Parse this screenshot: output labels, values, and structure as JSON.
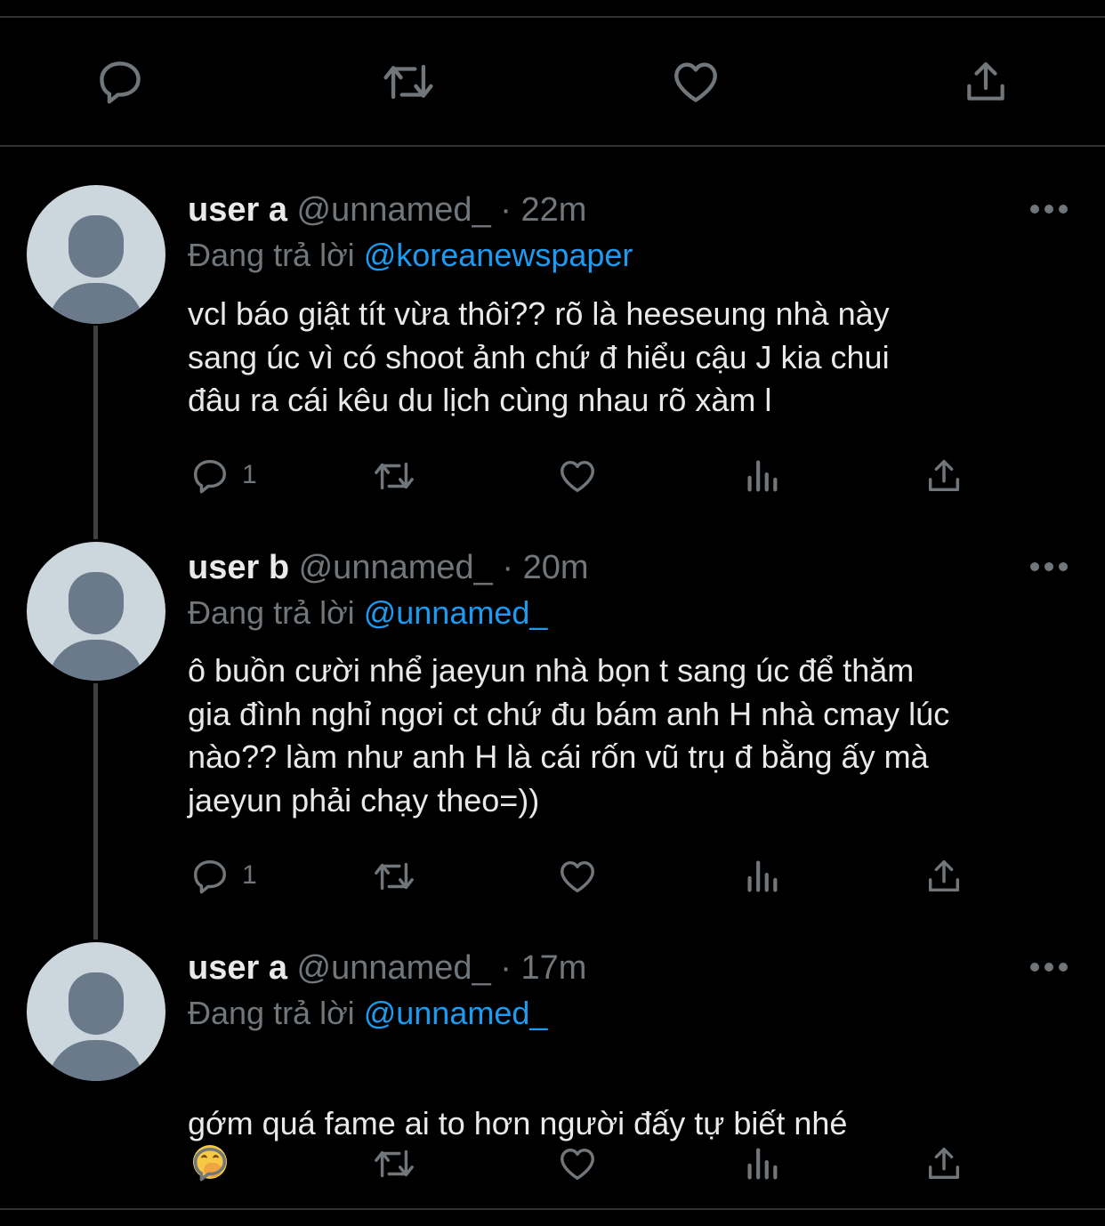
{
  "tweets": [
    {
      "name": "user a",
      "handle": "@unnamed_",
      "sep": "·",
      "time": "22m",
      "replying_prefix": "Đang trả lời",
      "replying_to": "@koreanewspaper",
      "text": "vcl báo giật tít vừa thôi?? rõ là heeseung nhà này\nsang úc vì có shoot ảnh chứ đ hiểu cậu J kia chui\nđâu ra cái kêu du lịch cùng nhau rõ xàm l",
      "reply_count": "1"
    },
    {
      "name": "user b",
      "handle": "@unnamed_",
      "sep": "·",
      "time": "20m",
      "replying_prefix": "Đang trả lời",
      "replying_to": "@unnamed_",
      "text": "ô buồn cười nhể jaeyun nhà bọn t sang úc để thăm\ngia đình nghỉ ngơi ct chứ đu bám anh H nhà cmay lúc\nnào?? làm như anh H là cái rốn vũ trụ đ bằng ấy mà\njaeyun phải chạy theo=))",
      "reply_count": "1"
    },
    {
      "name": "user a",
      "handle": "@unnamed_",
      "sep": "·",
      "time": "17m",
      "replying_prefix": "Đang trả lời",
      "replying_to": "@unnamed_",
      "text": "gớm quá fame ai to hơn người đấy tự biết nhé",
      "emoji": "face-with-hand-over-mouth",
      "reply_count": ""
    }
  ],
  "icons": {
    "reply": "reply-icon",
    "retweet": "retweet-icon",
    "like": "heart-icon",
    "analytics": "analytics-icon",
    "share": "share-icon",
    "more": "more-icon"
  },
  "colors": {
    "background": "#000000",
    "text": "#e7e9ea",
    "muted": "#71767b",
    "link": "#1d9bf0",
    "divider": "#2f3336",
    "avatar_bg": "#ccd6dd",
    "avatar_fg": "#6a7a8a"
  }
}
